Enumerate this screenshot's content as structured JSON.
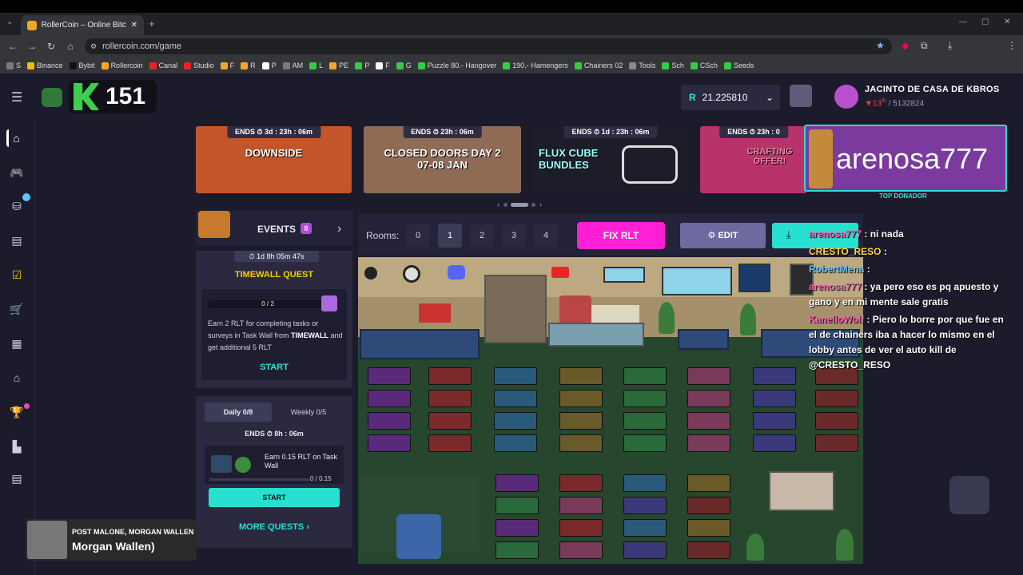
{
  "browser": {
    "tab_title": "RollerCoin – Online Bitcoin Mi",
    "url": "rollercoin.com/game",
    "bookmarks": [
      "S",
      "Binance",
      "Bybit",
      "Rollercoin",
      "Canal",
      "Studio",
      "F",
      "R",
      "P",
      "AM",
      "L",
      "PE",
      "P",
      "F",
      "G",
      "Puzzle 80.- Hangover",
      "190.- Hamengers",
      "Chainers 02",
      "Tools",
      "Sch",
      "CSch",
      "Seeds"
    ]
  },
  "header": {
    "viewer_count": "151",
    "balance": "21.225810",
    "balance_currency": "R",
    "username": "JACINTO DE CASA DE KBROS",
    "rank": "13",
    "rank_suffix": "th",
    "rank_total": "/ 5132824"
  },
  "banners": [
    {
      "ends": "ENDS  ⏱ 3d : 23h : 06m",
      "title": "DOWNSIDE",
      "color": "#c2552a"
    },
    {
      "ends": "ENDS  ⏱ 23h : 06m",
      "title": "CLOSED DOORS DAY 2 07-08 JAN",
      "color": "#8f6b56"
    },
    {
      "ends": "ENDS  ⏱ 1d : 23h : 06m",
      "title": "FLUX CUBE BUNDLES",
      "color": "#1d1d2a"
    },
    {
      "ends": "ENDS  ⏱ 23h : 0",
      "title": "CRAFTING OFFER!",
      "color": "#b8336a"
    }
  ],
  "donor": {
    "name": "arenosa777",
    "label": "TOP DONADOR"
  },
  "events": {
    "title": "EVENTS",
    "count": "8",
    "timer": "1d 8h 05m 47s",
    "quest_title": "TIMEWALL QUEST",
    "progress": "0 / 2",
    "progress_fraction": 0,
    "desc_1": "Earn 2 RLT for completing tasks or surveys in Task Wall from ",
    "desc_bold": "TIMEWALL",
    "desc_2": " and get additional 5 RLT",
    "start": "START"
  },
  "daily": {
    "tab_daily": "Daily  0/8",
    "tab_weekly": "Weekly  0/5",
    "ends": "ENDS  ⏱ 8h : 06m",
    "task": "Earn 0.15 RLT on Task Wall",
    "task_progress": "0 / 0.15",
    "task_progress_fraction": 0,
    "start_button": "START",
    "more": "MORE QUESTS  ›"
  },
  "rooms": {
    "label": "Rooms:",
    "items": [
      "0",
      "1",
      "2",
      "3",
      "4"
    ],
    "active": "1",
    "fix_button": "FIX RLT",
    "edit_button": "EDIT"
  },
  "chat": [
    {
      "user": "arenosa777",
      "text": ": ni nada",
      "cls": "u"
    },
    {
      "user": "CRESTO_RESO",
      "text": ":",
      "cls": "u2"
    },
    {
      "user": "RobertMena",
      "text": ":",
      "cls": "u3"
    },
    {
      "user": "arenosa777",
      "text": ": ya pero eso es pq apuesto y gano y en mi mente sale gratis",
      "cls": "u"
    },
    {
      "user": "KanelloWolf",
      "text": ": Piero lo borre por que fue en el de chainers iba a hacer lo mismo en el lobby antes de ver el auto kill de @CRESTO_RESO",
      "cls": "u"
    }
  ],
  "music": {
    "artist": "POST MALONE, MORGAN WALLEN",
    "song": "Morgan Wallen)"
  }
}
